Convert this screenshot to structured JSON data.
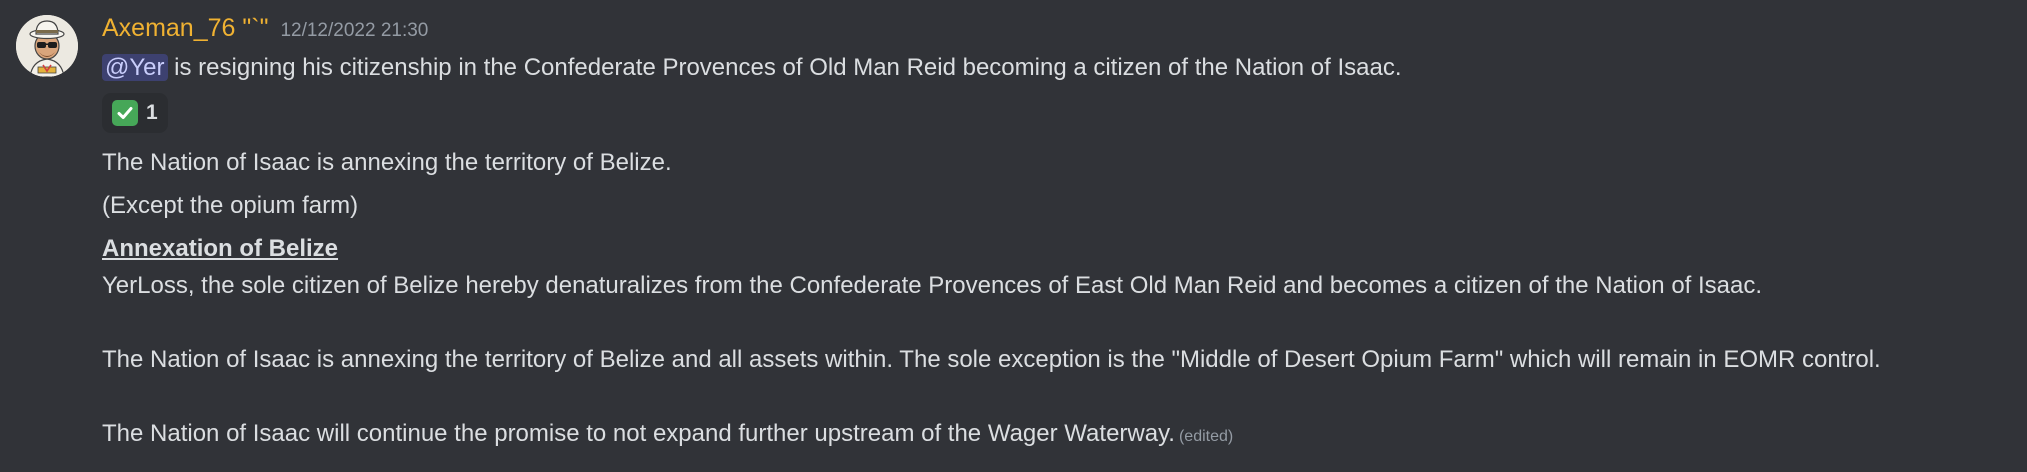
{
  "message": {
    "username": "Axeman_76 \"`\"",
    "timestamp": "12/12/2022 21:30",
    "line1": {
      "mention": "@Yer",
      "text": " is resigning his citizenship in the Confederate Provences of Old Man Reid becoming a citizen of the Nation of Isaac."
    },
    "reaction": {
      "emoji": "check-mark-emoji",
      "count": "1"
    },
    "line2": "The Nation of Isaac is annexing the territory of Belize.",
    "line3": "(Except the opium farm)",
    "heading": "Annexation of Belize",
    "para1": "YerLoss, the sole citizen of Belize hereby denaturalizes from the Confederate Provences of East Old Man Reid and becomes a citizen of the Nation of Isaac.",
    "para2": "The Nation of Isaac is annexing the territory of Belize and all assets within. The sole exception is the \"Middle of Desert Opium Farm\" which will remain in EOMR control.",
    "para3": "The Nation of Isaac will continue the promise to not expand further upstream of the Wager Waterway.",
    "edited": "(edited)"
  },
  "colors": {
    "background": "#313338",
    "username": "#f0b232",
    "text": "#dbdee1",
    "muted": "#949ba4",
    "mention_bg": "#4a4f8a",
    "reaction_bg": "#2b2d31",
    "check_green": "#46a758"
  }
}
